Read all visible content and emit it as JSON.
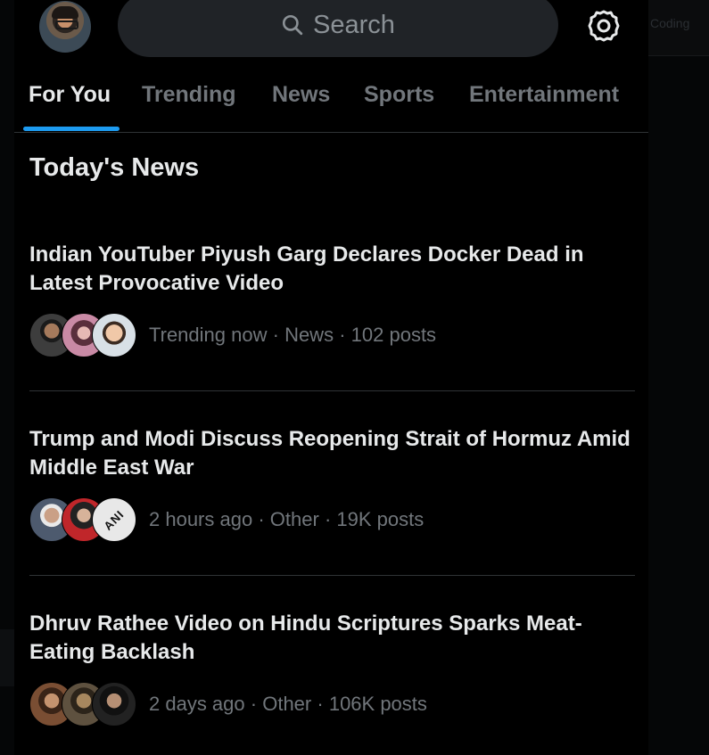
{
  "search": {
    "label": "Search"
  },
  "tabs": [
    {
      "label": "For You",
      "active": true
    },
    {
      "label": "Trending",
      "active": false
    },
    {
      "label": "News",
      "active": false
    },
    {
      "label": "Sports",
      "active": false
    },
    {
      "label": "Entertainment",
      "active": false
    }
  ],
  "side_text": "Coding",
  "section": {
    "title": "Today's News"
  },
  "news": [
    {
      "headline": "Indian YouTuber Piyush Garg Declares Docker Dead in Latest Provocative Video",
      "time": "Trending now",
      "category": "News",
      "posts": "102 posts"
    },
    {
      "headline": "Trump and Modi Discuss Reopening Strait of Hormuz Amid Middle East War",
      "time": "2 hours ago",
      "category": "Other",
      "posts": "19K posts",
      "badge": "ANI"
    },
    {
      "headline": "Dhruv Rathee Video on Hindu Scriptures Sparks Meat-Eating Backlash",
      "time": "2 days ago",
      "category": "Other",
      "posts": "106K posts"
    }
  ],
  "colors": {
    "accent": "#1d9bf0",
    "background": "#000000",
    "text": "#e7e9ea",
    "muted": "#71767b"
  },
  "icons": {
    "search": "search-icon",
    "settings": "gear-icon"
  }
}
